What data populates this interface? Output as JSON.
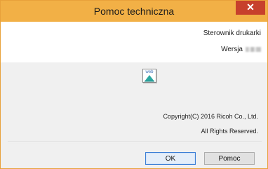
{
  "window": {
    "title": "Pomoc techniczna",
    "close_glyph": "✕"
  },
  "header": {
    "product": "Sterownik drukarki",
    "version_label": "Wersja"
  },
  "body": {
    "icon_text": "web",
    "icon": "web-icon",
    "copyright": "Copyright(C) 2016 Ricoh Co., Ltd.",
    "rights": "All Rights Reserved."
  },
  "buttons": {
    "ok_label": "OK",
    "help_label": "Pomoc"
  },
  "colors": {
    "titlebar": "#f2b046",
    "close": "#c7402c",
    "accent": "#3c7fd6"
  }
}
